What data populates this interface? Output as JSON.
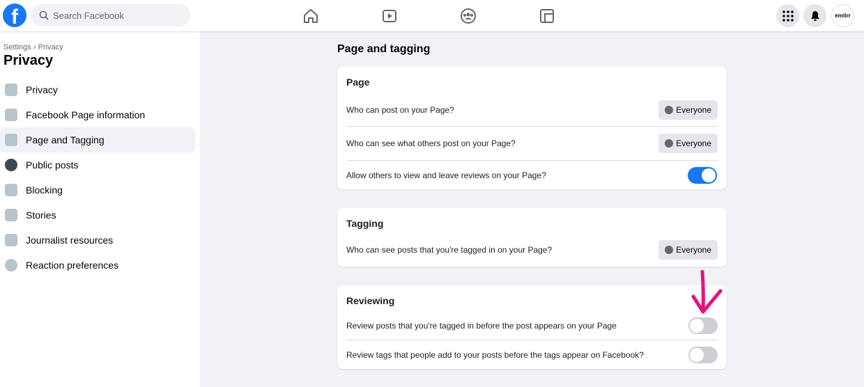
{
  "header": {
    "search_placeholder": "Search Facebook",
    "avatar_text": "emitrr"
  },
  "sidebar": {
    "breadcrumb": "Settings › Privacy",
    "title": "Privacy",
    "items": [
      {
        "label": "Privacy"
      },
      {
        "label": "Facebook Page information"
      },
      {
        "label": "Page and Tagging",
        "active": true
      },
      {
        "label": "Public posts"
      },
      {
        "label": "Blocking"
      },
      {
        "label": "Stories"
      },
      {
        "label": "Journalist resources"
      },
      {
        "label": "Reaction preferences"
      }
    ]
  },
  "main": {
    "heading": "Page and tagging",
    "page": {
      "title": "Page",
      "rows": [
        {
          "label": "Who can post on your Page?",
          "value": "Everyone"
        },
        {
          "label": "Who can see what others post on your Page?",
          "value": "Everyone"
        },
        {
          "label": "Allow others to view and leave reviews on your Page?",
          "toggle": true
        }
      ]
    },
    "tagging": {
      "title": "Tagging",
      "rows": [
        {
          "label": "Who can see posts that you're tagged in on your Page?",
          "value": "Everyone"
        }
      ]
    },
    "reviewing": {
      "title": "Reviewing",
      "rows": [
        {
          "label": "Review posts that you're tagged in before the post appears on your Page",
          "toggle": false
        },
        {
          "label": "Review tags that people add to your posts before the tags appear on Facebook?",
          "toggle": false
        }
      ]
    }
  },
  "colors": {
    "accent": "#1877f2",
    "annotation": "#e8127c"
  }
}
